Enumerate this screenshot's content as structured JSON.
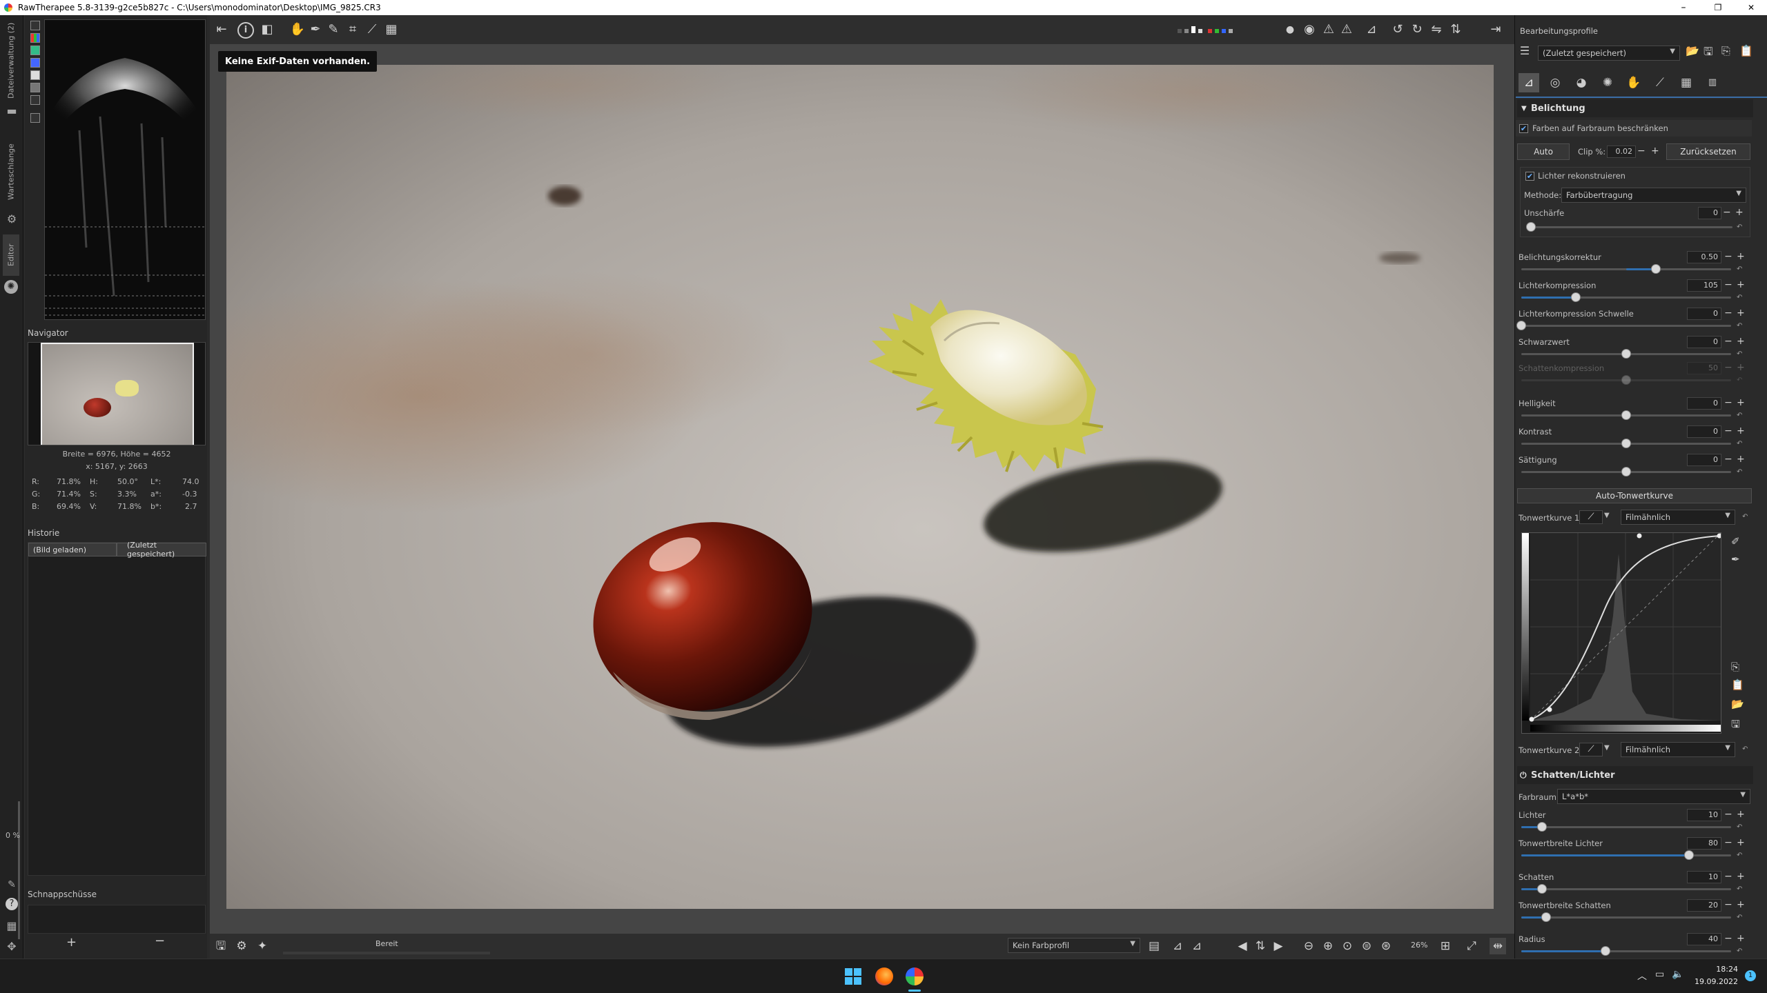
{
  "window": {
    "title": "RawTherapee 5.8-3139-g2ce5b827c - C:\\Users\\monodominator\\Desktop\\IMG_9825.CR3",
    "minimize": "–",
    "maximize": "❐",
    "close": "✕"
  },
  "vertical_tabs": {
    "file_browser": "Dateiverwaltung (2)",
    "queue": "Warteschlange",
    "editor": "Editor"
  },
  "navigator": {
    "title": "Navigator",
    "size": "Breite = 6976, Höhe = 4652",
    "coords": "x: 5167, y: 2663",
    "r_label": "R:",
    "r_val": "71.8%",
    "g_label": "G:",
    "g_val": "71.4%",
    "b_label": "B:",
    "b_val": "69.4%",
    "h_label": "H:",
    "h_val": "50.0°",
    "s_label": "S:",
    "s_val": "3.3%",
    "v_label": "V:",
    "v_val": "71.8%",
    "l_label": "L*:",
    "l_val": "74.0",
    "a_label": "a*:",
    "a_val": "-0.3",
    "bb_label": "b*:",
    "bb_val": "2.7"
  },
  "history": {
    "title": "Historie",
    "item_left": "(Bild geladen)",
    "item_right": "(Zuletzt gespeichert)"
  },
  "left_status": {
    "percent": "0 %"
  },
  "snapshots": {
    "title": "Schnappschüsse",
    "add": "+",
    "remove": "−"
  },
  "editor": {
    "exif_tooltip": "Keine Exif-Daten vorhanden.",
    "status": "Bereit",
    "color_profile": "Kein Farbprofil",
    "zoom": "26%"
  },
  "right_panel": {
    "profiles_title": "Bearbeitungsprofile",
    "profile_value": "(Zuletzt gespeichert)",
    "exposure": {
      "title": "Belichtung",
      "clip_gamut": "Farben auf Farbraum beschränken",
      "auto": "Auto",
      "clip_label": "Clip %:",
      "clip_value": "0.02",
      "reset": "Zurücksetzen",
      "hl_recon": "Lichter rekonstruieren",
      "method_label": "Methode:",
      "method_value": "Farbübertragung",
      "blur_label": "Unschärfe",
      "blur_value": "0",
      "exp_comp_label": "Belichtungskorrektur",
      "exp_comp_value": "0.50",
      "hl_comp_label": "Lichterkompression",
      "hl_comp_value": "105",
      "hl_thr_label": "Lichterkompression Schwelle",
      "hl_thr_value": "0",
      "black_label": "Schwarzwert",
      "black_value": "0",
      "shadow_comp_label": "Schattenkompression",
      "shadow_comp_value": "50",
      "lightness_label": "Helligkeit",
      "lightness_value": "0",
      "contrast_label": "Kontrast",
      "contrast_value": "0",
      "saturation_label": "Sättigung",
      "saturation_value": "0",
      "auto_curve": "Auto-Tonwertkurve",
      "curve1_label": "Tonwertkurve 1:",
      "curve1_mode": "Filmähnlich",
      "curve2_label": "Tonwertkurve 2:",
      "curve2_mode": "Filmähnlich"
    },
    "shadows_highlights": {
      "title": "Schatten/Lichter",
      "colorspace_label": "Farbraum:",
      "colorspace_value": "L*a*b*",
      "highlights_label": "Lichter",
      "highlights_value": "10",
      "hl_width_label": "Tonwertbreite Lichter",
      "hl_width_value": "80",
      "shadows_label": "Schatten",
      "shadows_value": "10",
      "sh_width_label": "Tonwertbreite Schatten",
      "sh_width_value": "20",
      "radius_label": "Radius",
      "radius_value": "40"
    }
  },
  "taskbar": {
    "time": "18:24",
    "date": "19.09.2022"
  }
}
